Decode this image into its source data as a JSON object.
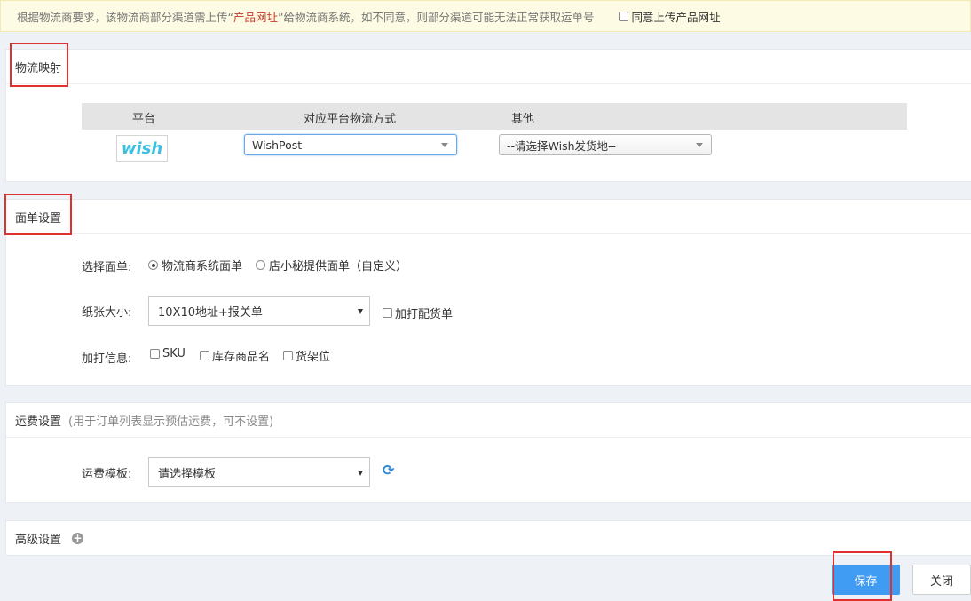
{
  "notice": {
    "text_before": "根据物流商要求，该物流商部分渠道需上传“",
    "highlight": "产品网址",
    "text_after": "”给物流商系统，如不同意，则部分渠道可能无法正常获取运单号",
    "agree_label": "同意上传产品网址"
  },
  "mapping": {
    "title": "物流映射",
    "columns": [
      "平台",
      "对应平台物流方式",
      "其他"
    ],
    "platform_logo_text": "wish",
    "logistics_method": "WishPost",
    "other_placeholder": "--请选择Wish发货地--"
  },
  "label_settings": {
    "title": "面单设置",
    "select_label": "选择面单:",
    "options": [
      "物流商系统面单",
      "店小秘提供面单（自定义）"
    ],
    "paper_label": "纸张大小:",
    "paper_value": "10X10地址+报关单",
    "extra_print_label": "加打配货单",
    "print_info_label": "加打信息:",
    "print_info_options": [
      "SKU",
      "库存商品名",
      "货架位"
    ]
  },
  "freight": {
    "title": "运费设置",
    "subtitle": "(用于订单列表显示预估运费，可不设置)",
    "template_label": "运费模板:",
    "template_placeholder": "请选择模板"
  },
  "advanced": {
    "title": "高级设置"
  },
  "buttons": {
    "save": "保存",
    "close": "关闭"
  },
  "colors": {
    "primary": "#3f9cf2",
    "highlight_box": "#e03131",
    "notice_bg": "#fdfbe3"
  }
}
